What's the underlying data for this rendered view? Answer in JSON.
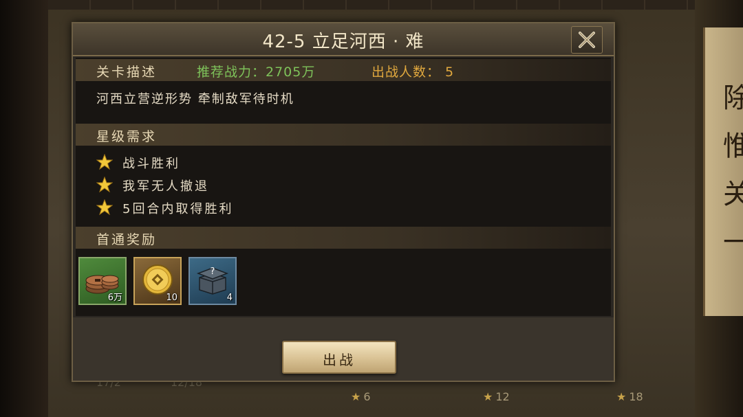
{
  "dialog": {
    "title": "42-5 立足河西 · 难",
    "close_icon": "close-icon"
  },
  "stage_info": {
    "section_label": "关卡描述",
    "recommended_power": "推荐战力：2705万",
    "deploy_count": "出战人数： 5",
    "description": "河西立营逆形势 牵制敌军待时机"
  },
  "star_requirements": {
    "section_label": "星级需求",
    "items": [
      {
        "icon": "star-icon",
        "text": "战斗胜利"
      },
      {
        "icon": "star-icon",
        "text": "我军无人撤退"
      },
      {
        "icon": "star-icon",
        "text": "5回合内取得胜利"
      }
    ]
  },
  "first_clear_rewards": {
    "section_label": "首通奖励",
    "items": [
      {
        "icon": "copper-coins-icon",
        "count": "6万"
      },
      {
        "icon": "gold-coin-icon",
        "count": "10"
      },
      {
        "icon": "mystery-chest-icon",
        "count": "4"
      }
    ]
  },
  "footer": {
    "fight_button": "出战"
  },
  "background": {
    "stat_left": "17/2",
    "stat_right": "12/18",
    "star_milestones": [
      "6",
      "12",
      "18"
    ],
    "scroll_chars": [
      "除",
      "惟",
      "关",
      "一"
    ]
  },
  "colors": {
    "accent_green": "#7ec25a",
    "accent_orange": "#e0a83e",
    "star_gold": "#f2c83a"
  }
}
